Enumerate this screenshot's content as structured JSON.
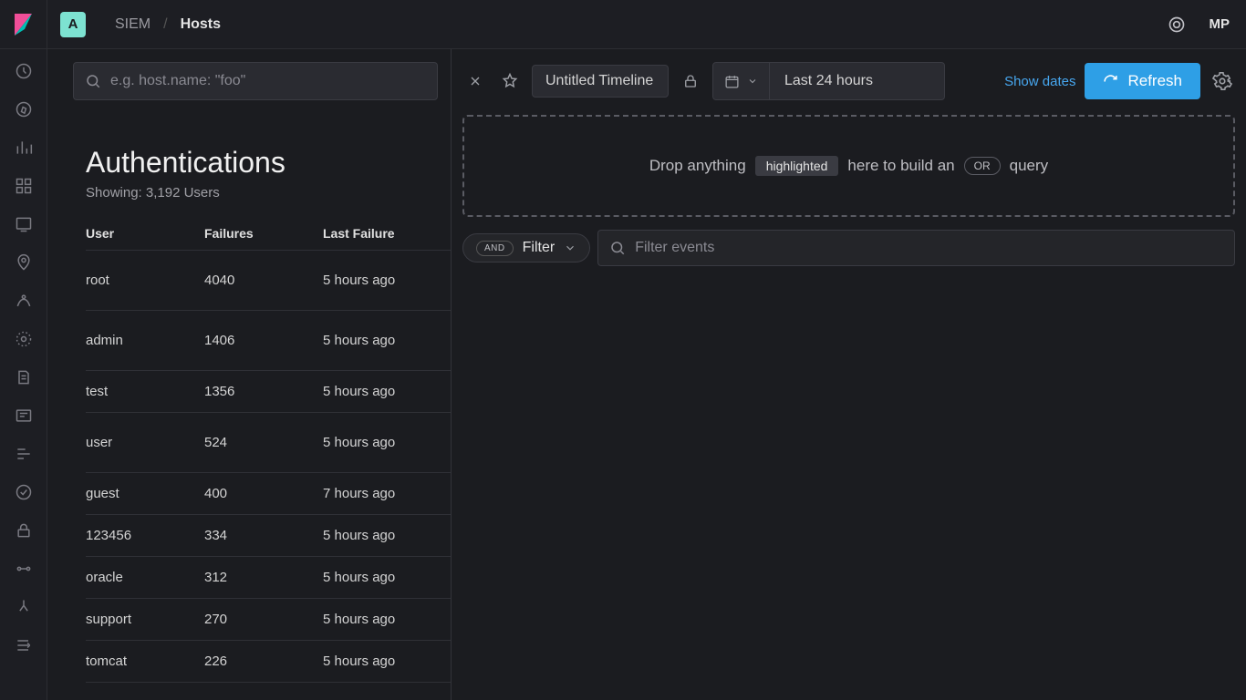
{
  "header": {
    "space_letter": "A",
    "breadcrumb": [
      "SIEM",
      "Hosts"
    ],
    "user_initials": "MP"
  },
  "left": {
    "search_placeholder": "e.g. host.name: \"foo\"",
    "title": "Authentications",
    "subtitle": "Showing: 3,192 Users",
    "columns": {
      "user": "User",
      "failures": "Failures",
      "last_failure": "Last Failure"
    },
    "rows": [
      {
        "user": "root",
        "failures": "4040",
        "last_failure": "5 hours ago",
        "tall": true
      },
      {
        "user": "admin",
        "failures": "1406",
        "last_failure": "5 hours ago",
        "tall": true
      },
      {
        "user": "test",
        "failures": "1356",
        "last_failure": "5 hours ago"
      },
      {
        "user": "user",
        "failures": "524",
        "last_failure": "5 hours ago",
        "tall": true
      },
      {
        "user": "guest",
        "failures": "400",
        "last_failure": "7 hours ago"
      },
      {
        "user": "123456",
        "failures": "334",
        "last_failure": "5 hours ago"
      },
      {
        "user": "oracle",
        "failures": "312",
        "last_failure": "5 hours ago"
      },
      {
        "user": "support",
        "failures": "270",
        "last_failure": "5 hours ago"
      },
      {
        "user": "tomcat",
        "failures": "226",
        "last_failure": "5 hours ago"
      }
    ]
  },
  "timeline": {
    "name": "Untitled Timeline",
    "date_range": "Last 24 hours",
    "show_dates_label": "Show dates",
    "refresh_label": "Refresh",
    "drop_hint_pre": "Drop anything",
    "drop_hint_chip": "highlighted",
    "drop_hint_mid": "here to build an",
    "drop_hint_or": "or",
    "drop_hint_post": "query",
    "and_label": "AND",
    "filter_label": "Filter",
    "filter_events_placeholder": "Filter events"
  }
}
